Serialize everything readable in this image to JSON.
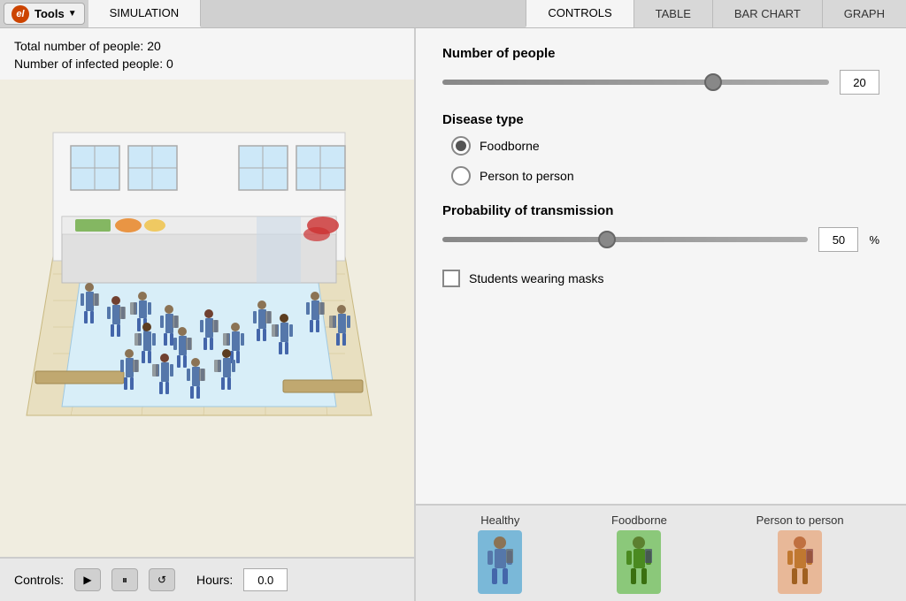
{
  "tabs": {
    "simulation": "SIMULATION",
    "controls": "CONTROLS",
    "table": "TABLE",
    "bar_chart": "BAR CHART",
    "graph": "GRAPH",
    "active_left": "simulation",
    "active_right": "controls"
  },
  "tools_btn": "Tools",
  "stats": {
    "total_people": "Total number of people: 20",
    "infected_people": "Number of infected people: 0"
  },
  "controls_panel": {
    "number_of_people_label": "Number of people",
    "number_of_people_value": "20",
    "disease_type_label": "Disease type",
    "foodborne_label": "Foodborne",
    "person_to_person_label": "Person to person",
    "probability_label": "Probability of transmission",
    "probability_value": "50",
    "probability_unit": "%",
    "masks_label": "Students wearing masks"
  },
  "controls_bar": {
    "label": "Controls:",
    "play_symbol": "▶",
    "pause_symbol": "⏸",
    "reset_symbol": "↺",
    "hours_label": "Hours:",
    "hours_value": "0.0"
  },
  "legend": {
    "healthy_label": "Healthy",
    "foodborne_label": "Foodborne",
    "person_to_person_label": "Person to person"
  },
  "sliders": {
    "people_percent": 70,
    "transmission_percent": 45
  }
}
